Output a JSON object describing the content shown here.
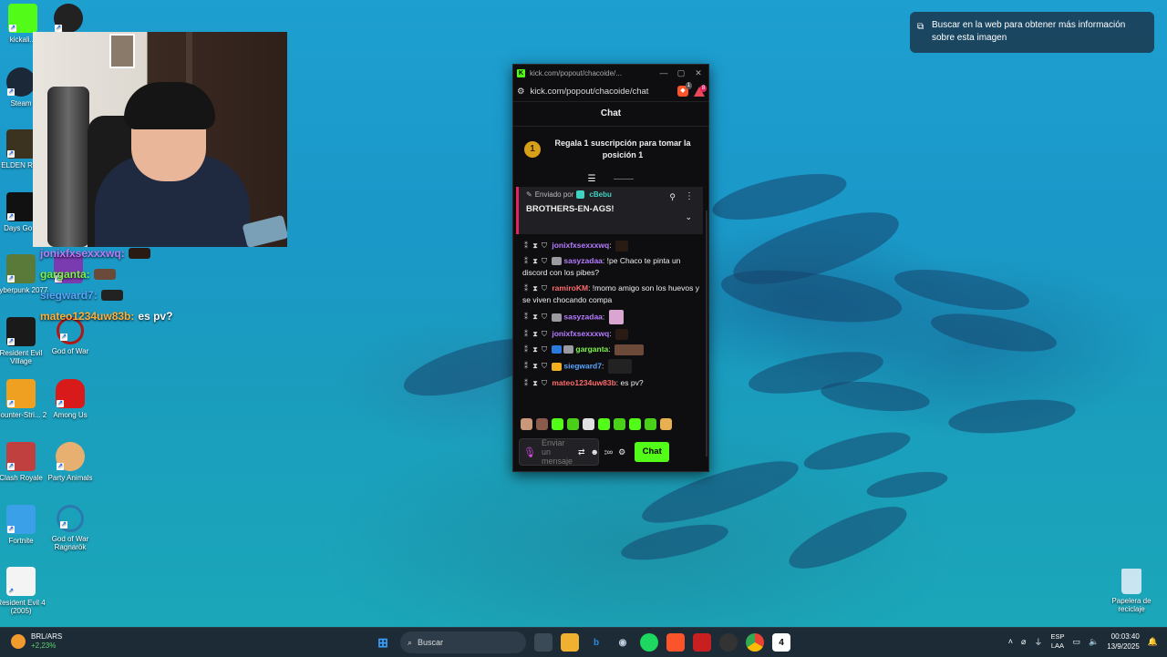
{
  "tooltip": {
    "text": "Buscar en la web para obtener más información sobre esta imagen"
  },
  "desktop_icons": [
    {
      "label": "Steam"
    },
    {
      "label": "ELDEN RI..."
    },
    {
      "label": "Days Go..."
    },
    {
      "label": "Cyberpunk 2077"
    },
    {
      "label": "Resident Evil Village"
    },
    {
      "label": "God of War"
    },
    {
      "label": "Counter-Stri... 2"
    },
    {
      "label": "Among Us"
    },
    {
      "label": "Clash Royale"
    },
    {
      "label": "Party Animals"
    },
    {
      "label": "Fortnite"
    },
    {
      "label": "God of War Ragnarök"
    },
    {
      "label": "Resident Evil 4 (2005)"
    },
    {
      "label": "Papelera de reciclaje"
    },
    {
      "label": "kickali..."
    }
  ],
  "overlay_chat": [
    {
      "user": "jonixfxsexxxwq:",
      "text": ""
    },
    {
      "user": "garganta:",
      "text": ""
    },
    {
      "user": "siegward7:",
      "text": ""
    },
    {
      "user": "mateo1234uw83b:",
      "text": "es pv?"
    }
  ],
  "popup": {
    "window_title": "kick.com/popout/chacoide/...",
    "address": "kick.com/popout/chacoide/chat",
    "brave_badge": "1",
    "alert_badge": "8",
    "header": "Chat",
    "goal": {
      "rank": "1",
      "text": "Regala 1 suscripción para tomar la posición 1"
    },
    "pinned": {
      "prefix": "Enviado por",
      "user": "cBebu",
      "message": "BROTHERS-EN-AGS!"
    },
    "messages": [
      {
        "user": "jonixfxsexxxwq",
        "sep": ":",
        "text": "",
        "color": "purple"
      },
      {
        "user": "sasyzadaa",
        "sep": ":",
        "text": " !pe Chaco te pinta un discord con los pibes?",
        "color": "purple"
      },
      {
        "user": "ramiroKM",
        "sep": ":",
        "text": " !momo amigo son los huevos y se viven chocando compa",
        "color": "red"
      },
      {
        "user": "sasyzadaa",
        "sep": ":",
        "text": "",
        "color": "purple"
      },
      {
        "user": "jonixfxsexxxwq",
        "sep": ":",
        "text": "",
        "color": "purple"
      },
      {
        "user": "garganta",
        "sep": ":",
        "text": "",
        "color": "green"
      },
      {
        "user": "siegward7",
        "sep": ":",
        "text": "",
        "color": "blue"
      },
      {
        "user": "mateo1234uw83b",
        "sep": ":",
        "text": " es pv?",
        "color": "red"
      }
    ],
    "input_placeholder": "Enviar un mensaje",
    "chat_button": "Chat"
  },
  "taskbar": {
    "currency": "BRL/ARS",
    "change": "+2,23%",
    "search_label": "Buscar",
    "lang_1": "ESP",
    "lang_2": "LAA",
    "time": "00:03:40",
    "date": "13/9/2025"
  },
  "colors": {
    "kick_green": "#53fc18",
    "taskbar": "#1c2b36",
    "desktop_blue": "#1a9dbd"
  }
}
